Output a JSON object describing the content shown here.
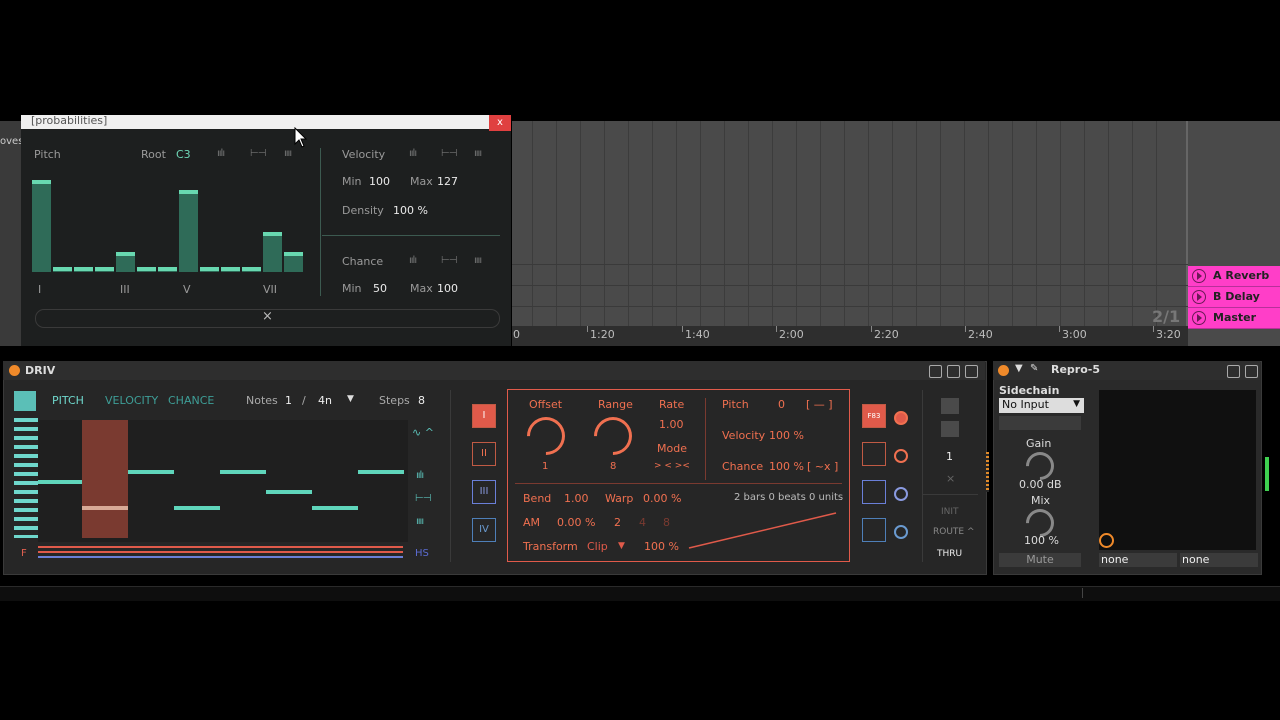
{
  "probabilities": {
    "title": "[probabilities]",
    "close": "x",
    "pitch_label": "Pitch",
    "root_label": "Root",
    "root_value": "C3",
    "degree_labels": [
      "I",
      "III",
      "V",
      "VII"
    ],
    "bars": [
      0.92,
      0.05,
      0.05,
      0.05,
      0.2,
      0.05,
      0.05,
      0.82,
      0.05,
      0.05,
      0.05,
      0.4,
      0.2
    ],
    "velocity_label": "Velocity",
    "vel_min_label": "Min",
    "vel_min": "100",
    "vel_max_label": "Max",
    "vel_max": "127",
    "density_label": "Density",
    "density": "100 %",
    "chance_label": "Chance",
    "ch_min_label": "Min",
    "ch_min": "50",
    "ch_max_label": "Max",
    "ch_max": "100",
    "reset": "×",
    "left_cut": "oves"
  },
  "arrangement": {
    "ruler": [
      "0",
      "1:20",
      "1:40",
      "2:00",
      "2:20",
      "2:40",
      "3:00",
      "3:20"
    ],
    "signature": "2/1",
    "returns": [
      "A Reverb",
      "B Delay",
      "Master"
    ]
  },
  "driv": {
    "title": "DRIV",
    "tabs": [
      "PITCH",
      "VELOCITY",
      "CHANCE"
    ],
    "notes_label": "Notes",
    "notes_value": "1",
    "notes_sep": "/",
    "notes_div": "4n",
    "steps_label": "Steps",
    "steps_value": "8",
    "f_label": "F",
    "hs_label": "HS",
    "roman": [
      "I",
      "II",
      "III",
      "IV"
    ],
    "offset_label": "Offset",
    "offset_value": "1",
    "range_label": "Range",
    "range_value": "8",
    "rate_label": "Rate",
    "rate_value": "1.00",
    "mode_label": "Mode",
    "mode_value": "> < ><",
    "pitch_label": "Pitch",
    "pitch_value": "0",
    "pitch_bracket": "[ — ]",
    "velocity_label": "Velocity",
    "velocity_value": "100 %",
    "chance_label": "Chance",
    "chance_value": "100 %",
    "chance_bracket": "[ ~x ]",
    "bend_label": "Bend",
    "bend_value": "1.00",
    "warp_label": "Warp",
    "warp_value": "0.00 %",
    "length_text": "2 bars 0 beats 0 units",
    "am_label": "AM",
    "am_value": "0.00 %",
    "am_steps": [
      "2",
      "4",
      "8"
    ],
    "transform_label": "Transform",
    "transform_value": "Clip",
    "transform_pct": "100 %",
    "fb_label": "F83",
    "side_value": "1",
    "side_x": "×",
    "init": "INIT",
    "route": "ROUTE ^",
    "thru": "THRU"
  },
  "repro": {
    "title": "Repro-5",
    "sidechain_label": "Sidechain",
    "sidechain_value": "No Input",
    "gain_label": "Gain",
    "gain_value": "0.00 dB",
    "mix_label": "Mix",
    "mix_value": "100 %",
    "mute": "Mute",
    "none1": "none",
    "none2": "none"
  }
}
